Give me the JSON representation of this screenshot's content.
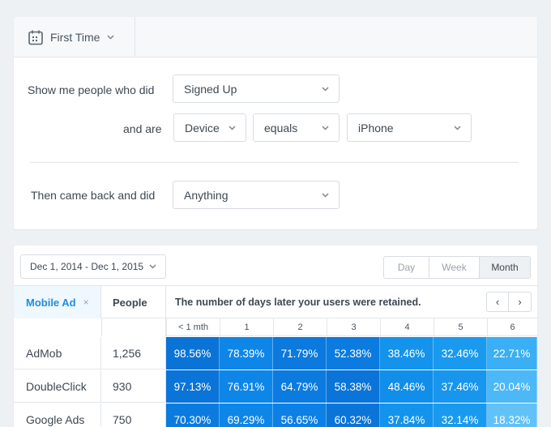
{
  "filter": {
    "first_time_label": "First Time",
    "show_me_label": "Show me people who did",
    "event_value": "Signed Up",
    "and_are_label": "and are",
    "property_value": "Device",
    "operator_value": "equals",
    "property_match_value": "iPhone",
    "came_back_label": "Then came back and did",
    "return_event_value": "Anything"
  },
  "report": {
    "date_range": "Dec 1, 2014 - Dec 1, 2015",
    "granularity": [
      "Day",
      "Week",
      "Month"
    ],
    "active_granularity": "Month",
    "segment_label": "Mobile Ad",
    "segment_remove": "×",
    "people_label": "People",
    "days_label": "The number of days later your users were retained.",
    "pager_prev": "‹",
    "pager_next": "›",
    "periods": [
      "< 1 mth",
      "1",
      "2",
      "3",
      "4",
      "5",
      "6"
    ],
    "rows": [
      {
        "name": "AdMob",
        "people": "1,256",
        "values": [
          "98.56%",
          "78.39%",
          "71.79%",
          "52.38%",
          "38.46%",
          "32.46%",
          "22.71%"
        ],
        "colors": [
          "#0a73d6",
          "#0e86e8",
          "#0b79dd",
          "#0b7be0",
          "#1393ec",
          "#1a9aef",
          "#3aaff5"
        ]
      },
      {
        "name": "DoubleClick",
        "people": "930",
        "values": [
          "97.13%",
          "76.91%",
          "64.79%",
          "58.38%",
          "48.46%",
          "37.46%",
          "20.04%"
        ],
        "colors": [
          "#0a74d8",
          "#0e86e8",
          "#0b7be0",
          "#0a74d8",
          "#118ee9",
          "#1896ed",
          "#4cb8f7"
        ]
      },
      {
        "name": "Google Ads",
        "people": "750",
        "values": [
          "70.30%",
          "69.29%",
          "56.65%",
          "60.32%",
          "37.84%",
          "32.14%",
          "18.32%"
        ],
        "colors": [
          "#0b7bdf",
          "#0e86e8",
          "#0c80e4",
          "#0a74d8",
          "#1393ec",
          "#1a9aef",
          "#62c2f8"
        ]
      }
    ]
  }
}
